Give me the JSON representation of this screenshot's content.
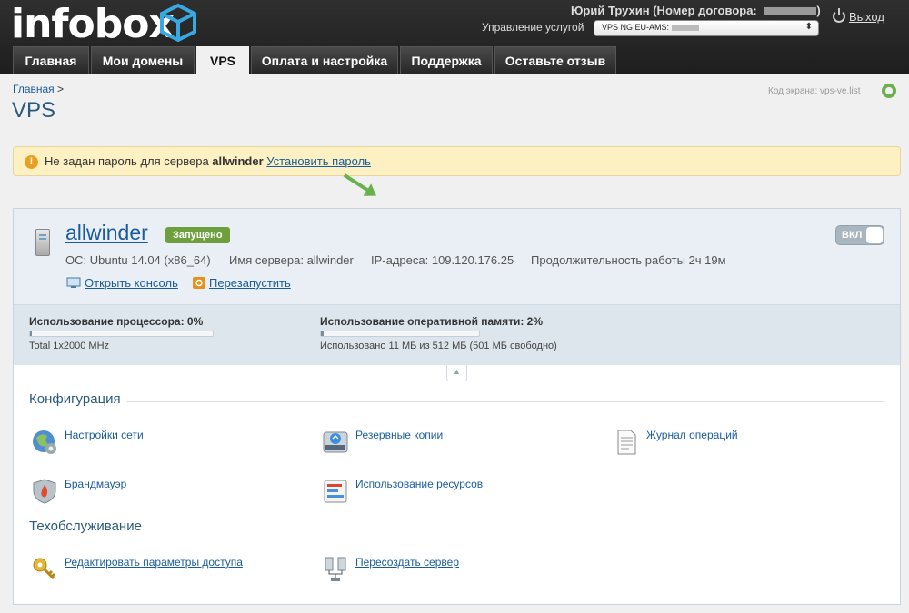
{
  "header": {
    "logo": "infobox",
    "user": "Юрий Трухин (Номер договора: ",
    "user_close": ")",
    "services_label": "Управление услугой",
    "service_selected": "VPS NG EU-AMS:",
    "logout": "Выход"
  },
  "tabs": [
    {
      "label": "Главная"
    },
    {
      "label": "Мои домены"
    },
    {
      "label": "VPS"
    },
    {
      "label": "Оплата и настройка"
    },
    {
      "label": "Поддержка"
    },
    {
      "label": "Оставьте отзыв"
    }
  ],
  "breadcrumb": {
    "home": "Главная",
    "separator": ">"
  },
  "page_title": "VPS",
  "screen_code": "Код экрана:  vps-ve.list",
  "warning": {
    "icon": "!",
    "text": "Не задан пароль для сервера ",
    "server": "allwinder",
    "link": "Установить пароль"
  },
  "server": {
    "name": "allwinder",
    "status": "Запущено",
    "toggle": "ВКЛ",
    "os": "ОС: Ubuntu 14.04 (x86_64)",
    "hostname": "Имя сервера: allwinder",
    "ip": "IP-адреса: 109.120.176.25",
    "uptime": "Продолжительность работы 2ч 19м",
    "open_console": "Открыть консоль",
    "restart": "Перезапустить"
  },
  "usage": {
    "cpu_label": "Использование процессора: 0%",
    "cpu_percent": 0,
    "cpu_note": "Total 1x2000 MHz",
    "ram_label": "Использование оперативной памяти: 2%",
    "ram_percent": 2,
    "ram_note": "Использовано 11 МБ из 512 МБ (501 МБ свободно)"
  },
  "sections": {
    "config_title": "Конфигурация",
    "maintenance_title": "Техобслуживание",
    "network": "Настройки сети",
    "backups": "Резервные копии",
    "journal": "Журнал операций",
    "firewall": "Брандмауэр",
    "resources": "Использование ресурсов",
    "access": "Редактировать параметры доступа",
    "recreate": "Пересоздать сервер"
  }
}
